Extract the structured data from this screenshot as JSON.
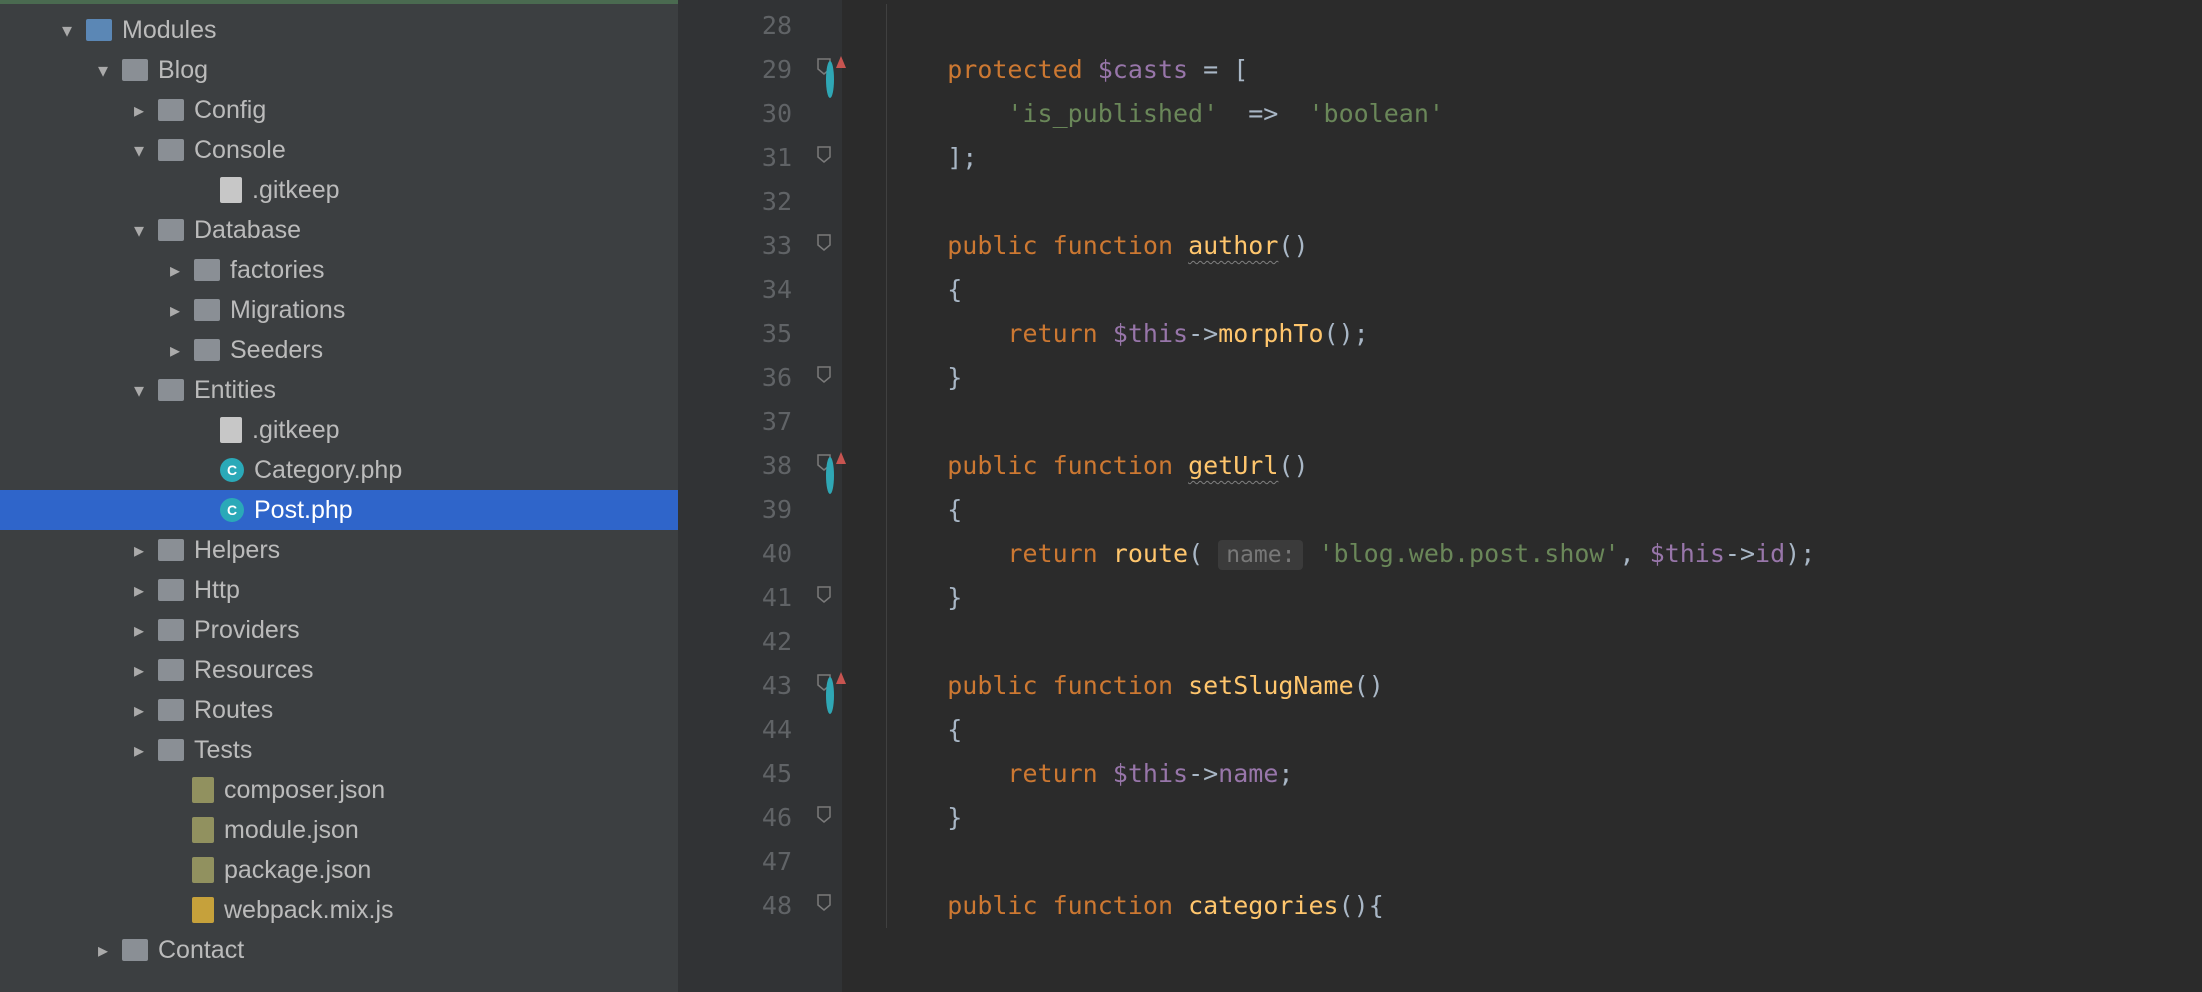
{
  "tree": [
    {
      "indent": 58,
      "arrow": "down",
      "icon": "folder open",
      "label": "Modules"
    },
    {
      "indent": 94,
      "arrow": "down",
      "icon": "folder",
      "label": "Blog"
    },
    {
      "indent": 130,
      "arrow": "right",
      "icon": "folder",
      "label": "Config"
    },
    {
      "indent": 130,
      "arrow": "down",
      "icon": "folder",
      "label": "Console"
    },
    {
      "indent": 192,
      "arrow": "",
      "icon": "file",
      "label": ".gitkeep"
    },
    {
      "indent": 130,
      "arrow": "down",
      "icon": "folder",
      "label": "Database"
    },
    {
      "indent": 166,
      "arrow": "right",
      "icon": "folder",
      "label": "factories"
    },
    {
      "indent": 166,
      "arrow": "right",
      "icon": "folder",
      "label": "Migrations"
    },
    {
      "indent": 166,
      "arrow": "right",
      "icon": "folder",
      "label": "Seeders"
    },
    {
      "indent": 130,
      "arrow": "down",
      "icon": "folder",
      "label": "Entities"
    },
    {
      "indent": 192,
      "arrow": "",
      "icon": "file",
      "label": ".gitkeep"
    },
    {
      "indent": 192,
      "arrow": "",
      "icon": "php",
      "label": "Category.php"
    },
    {
      "indent": 192,
      "arrow": "",
      "icon": "php",
      "label": "Post.php",
      "selected": true
    },
    {
      "indent": 130,
      "arrow": "right",
      "icon": "folder",
      "label": "Helpers"
    },
    {
      "indent": 130,
      "arrow": "right",
      "icon": "folder",
      "label": "Http"
    },
    {
      "indent": 130,
      "arrow": "right",
      "icon": "folder",
      "label": "Providers"
    },
    {
      "indent": 130,
      "arrow": "right",
      "icon": "folder",
      "label": "Resources"
    },
    {
      "indent": 130,
      "arrow": "right",
      "icon": "folder",
      "label": "Routes"
    },
    {
      "indent": 130,
      "arrow": "right",
      "icon": "folder",
      "label": "Tests"
    },
    {
      "indent": 164,
      "arrow": "",
      "icon": "json",
      "label": "composer.json"
    },
    {
      "indent": 164,
      "arrow": "",
      "icon": "json",
      "label": "module.json"
    },
    {
      "indent": 164,
      "arrow": "",
      "icon": "json",
      "label": "package.json"
    },
    {
      "indent": 164,
      "arrow": "",
      "icon": "js",
      "label": "webpack.mix.js"
    },
    {
      "indent": 94,
      "arrow": "right",
      "icon": "folder",
      "label": "Contact"
    }
  ],
  "code": {
    "first_line": 28,
    "lines": [
      {
        "n": 28,
        "txt": ""
      },
      {
        "n": 29,
        "mark": true,
        "fold": true,
        "html": "<span class='kw'>protected</span> <span class='var'>$casts</span> <span class='op'>= [</span>"
      },
      {
        "n": 30,
        "html": "    <span class='str'>'is_published'</span>  <span class='op'>=&gt;</span>  <span class='str'>'boolean'</span>"
      },
      {
        "n": 31,
        "fold": true,
        "html": "<span class='op'>];</span>"
      },
      {
        "n": 32,
        "html": ""
      },
      {
        "n": 33,
        "fold": true,
        "html": "<span class='kw'>public</span> <span class='kw'>function</span> <span class='name wavy'>author</span><span class='op'>()</span>"
      },
      {
        "n": 34,
        "html": "<span class='op'>{</span>"
      },
      {
        "n": 35,
        "html": "    <span class='kw'>return</span> <span class='var'>$this</span><span class='op'>-></span><span class='fn'>morphTo</span><span class='op'>();</span>"
      },
      {
        "n": 36,
        "fold": true,
        "html": "<span class='op'>}</span>"
      },
      {
        "n": 37,
        "html": ""
      },
      {
        "n": 38,
        "mark": true,
        "fold": true,
        "html": "<span class='kw'>public</span> <span class='kw'>function</span> <span class='name wavy'>getUrl</span><span class='op'>()</span>"
      },
      {
        "n": 39,
        "html": "<span class='op'>{</span>"
      },
      {
        "n": 40,
        "html": "    <span class='kw'>return</span> <span class='fn'>route</span><span class='op'>(</span> <span class='hint'>name:</span> <span class='str'>'blog.web.post.show'</span><span class='op'>,</span> <span class='var'>$this</span><span class='op'>-></span><span class='var'>id</span><span class='op'>);</span>"
      },
      {
        "n": 41,
        "fold": true,
        "html": "<span class='op'>}</span>"
      },
      {
        "n": 42,
        "html": ""
      },
      {
        "n": 43,
        "mark": true,
        "fold": true,
        "html": "<span class='kw'>public</span> <span class='kw'>function</span> <span class='name'>setSlugName</span><span class='op'>()</span>"
      },
      {
        "n": 44,
        "html": "<span class='op'>{</span>"
      },
      {
        "n": 45,
        "html": "    <span class='kw'>return</span> <span class='var'>$this</span><span class='op'>-></span><span class='var'>name</span><span class='op'>;</span>"
      },
      {
        "n": 46,
        "fold": true,
        "html": "<span class='op'>}</span>"
      },
      {
        "n": 47,
        "html": ""
      },
      {
        "n": 48,
        "fold": true,
        "html": "<span class='kw'>public</span> <span class='kw'>function</span> <span class='name'>categories</span><span class='op'>(){</span>"
      }
    ]
  },
  "icon_letters": {
    "php": "C"
  }
}
